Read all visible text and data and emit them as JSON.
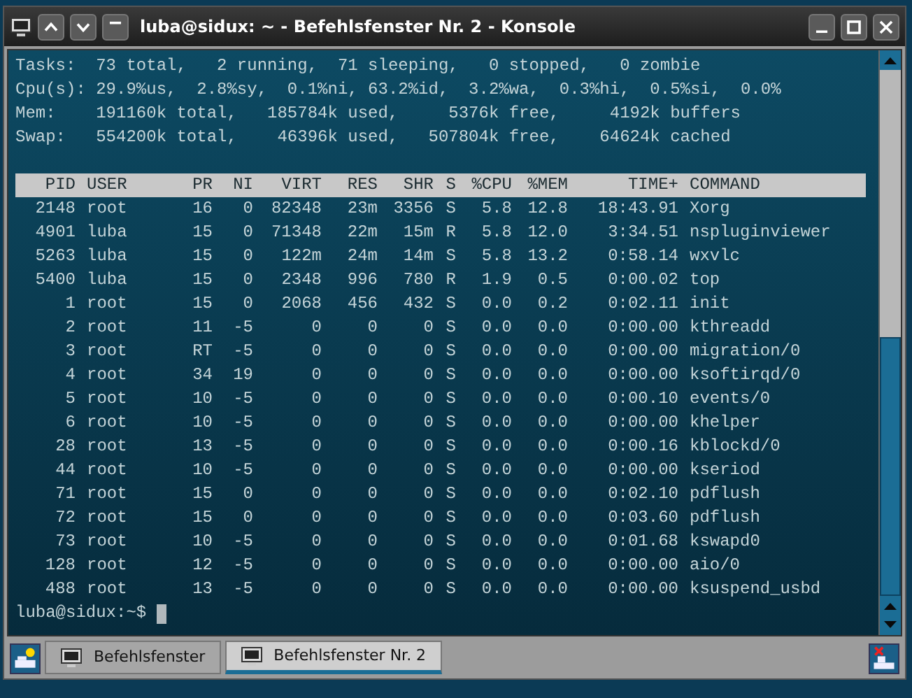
{
  "window": {
    "title": "luba@sidux: ~ - Befehlsfenster Nr. 2 - Konsole"
  },
  "summary": [
    "Tasks:  73 total,   2 running,  71 sleeping,   0 stopped,   0 zombie",
    "Cpu(s): 29.9%us,  2.8%sy,  0.1%ni, 63.2%id,  3.2%wa,  0.3%hi,  0.5%si,  0.0%",
    "Mem:    191160k total,   185784k used,     5376k free,     4192k buffers",
    "Swap:   554200k total,    46396k used,   507804k free,    64624k cached"
  ],
  "table": {
    "columns": [
      "PID",
      "USER",
      "PR",
      "NI",
      "VIRT",
      "RES",
      "SHR",
      "S",
      "%CPU",
      "%MEM",
      "TIME+",
      "COMMAND"
    ],
    "rows": [
      [
        "2148",
        "root",
        "16",
        "0",
        "82348",
        "23m",
        "3356",
        "S",
        "5.8",
        "12.8",
        "18:43.91",
        "Xorg"
      ],
      [
        "4901",
        "luba",
        "15",
        "0",
        "71348",
        "22m",
        "15m",
        "R",
        "5.8",
        "12.0",
        "3:34.51",
        "nspluginviewer"
      ],
      [
        "5263",
        "luba",
        "15",
        "0",
        "122m",
        "24m",
        "14m",
        "S",
        "5.8",
        "13.2",
        "0:58.14",
        "wxvlc"
      ],
      [
        "5400",
        "luba",
        "15",
        "0",
        "2348",
        "996",
        "780",
        "R",
        "1.9",
        "0.5",
        "0:00.02",
        "top"
      ],
      [
        "1",
        "root",
        "15",
        "0",
        "2068",
        "456",
        "432",
        "S",
        "0.0",
        "0.2",
        "0:02.11",
        "init"
      ],
      [
        "2",
        "root",
        "11",
        "-5",
        "0",
        "0",
        "0",
        "S",
        "0.0",
        "0.0",
        "0:00.00",
        "kthreadd"
      ],
      [
        "3",
        "root",
        "RT",
        "-5",
        "0",
        "0",
        "0",
        "S",
        "0.0",
        "0.0",
        "0:00.00",
        "migration/0"
      ],
      [
        "4",
        "root",
        "34",
        "19",
        "0",
        "0",
        "0",
        "S",
        "0.0",
        "0.0",
        "0:00.00",
        "ksoftirqd/0"
      ],
      [
        "5",
        "root",
        "10",
        "-5",
        "0",
        "0",
        "0",
        "S",
        "0.0",
        "0.0",
        "0:00.10",
        "events/0"
      ],
      [
        "6",
        "root",
        "10",
        "-5",
        "0",
        "0",
        "0",
        "S",
        "0.0",
        "0.0",
        "0:00.00",
        "khelper"
      ],
      [
        "28",
        "root",
        "13",
        "-5",
        "0",
        "0",
        "0",
        "S",
        "0.0",
        "0.0",
        "0:00.16",
        "kblockd/0"
      ],
      [
        "44",
        "root",
        "10",
        "-5",
        "0",
        "0",
        "0",
        "S",
        "0.0",
        "0.0",
        "0:00.00",
        "kseriod"
      ],
      [
        "71",
        "root",
        "15",
        "0",
        "0",
        "0",
        "0",
        "S",
        "0.0",
        "0.0",
        "0:02.10",
        "pdflush"
      ],
      [
        "72",
        "root",
        "15",
        "0",
        "0",
        "0",
        "0",
        "S",
        "0.0",
        "0.0",
        "0:03.60",
        "pdflush"
      ],
      [
        "73",
        "root",
        "10",
        "-5",
        "0",
        "0",
        "0",
        "S",
        "0.0",
        "0.0",
        "0:01.68",
        "kswapd0"
      ],
      [
        "128",
        "root",
        "12",
        "-5",
        "0",
        "0",
        "0",
        "S",
        "0.0",
        "0.0",
        "0:00.00",
        "aio/0"
      ],
      [
        "488",
        "root",
        "13",
        "-5",
        "0",
        "0",
        "0",
        "S",
        "0.0",
        "0.0",
        "0:00.00",
        "ksuspend_usbd"
      ]
    ]
  },
  "prompt": "luba@sidux:~$",
  "tabs": [
    {
      "label": "Befehlsfenster",
      "selected": false
    },
    {
      "label": "Befehlsfenster Nr. 2",
      "selected": true
    }
  ]
}
